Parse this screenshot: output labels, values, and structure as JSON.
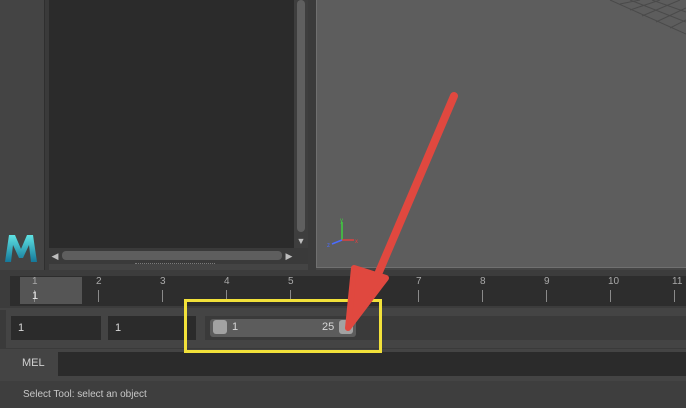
{
  "time_slider": {
    "tick_labels": [
      "1",
      "2",
      "3",
      "4",
      "5",
      "6",
      "7",
      "8",
      "9",
      "10",
      "11"
    ],
    "current_frame": "1"
  },
  "range_slider": {
    "start_time": "1",
    "anim_start_time": "1",
    "range_start": "1",
    "range_end": "25"
  },
  "command_line": {
    "language_label": "MEL",
    "value": ""
  },
  "help_line": {
    "text": "Select Tool: select an object"
  },
  "icons": {
    "logo": "maya-logo-icon",
    "axis": "axis-gizmo-icon",
    "arrow": "annotation-arrow"
  },
  "colors": {
    "highlight": "#f2e13a",
    "arrow": "#e0483f",
    "logo_top": "#3fd0d8",
    "logo_bottom": "#1a7f9a"
  }
}
